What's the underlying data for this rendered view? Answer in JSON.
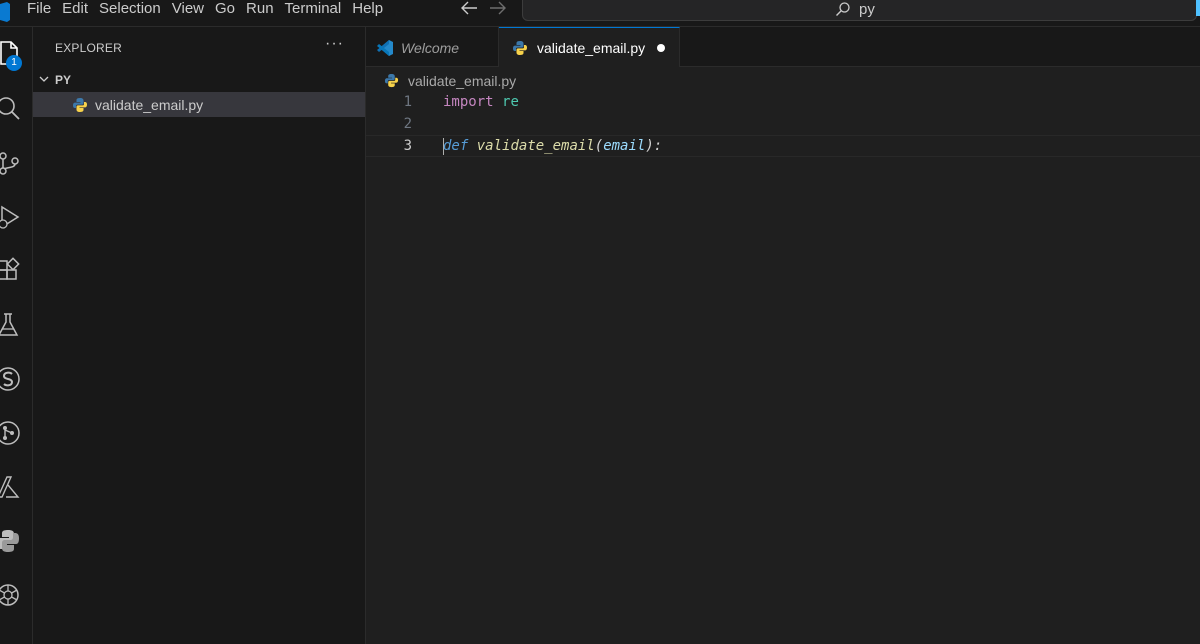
{
  "menu": [
    "File",
    "Edit",
    "Selection",
    "View",
    "Go",
    "Run",
    "Terminal",
    "Help"
  ],
  "command_center": {
    "text": "py"
  },
  "activity_bar": {
    "badge": "1",
    "icons": [
      "explorer-icon",
      "search-icon",
      "source-control-icon",
      "run-debug-icon",
      "extensions-icon",
      "testing-icon",
      "snippets-icon",
      "git-graph-icon",
      "azure-icon",
      "python-icon",
      "openai-icon"
    ]
  },
  "sidebar": {
    "title": "EXPLORER",
    "more_actions": "···",
    "folder": "PY",
    "files": [
      {
        "name": "validate_email.py"
      }
    ]
  },
  "tabs": [
    {
      "label": "Welcome",
      "icon": "vscode-icon",
      "active": false
    },
    {
      "label": "validate_email.py",
      "icon": "python-file-icon",
      "active": true,
      "dirty": true
    }
  ],
  "breadcrumb": {
    "file": "validate_email.py"
  },
  "code": {
    "lines": [
      {
        "n": "1",
        "kw": "import",
        "mod": "re"
      },
      {
        "n": "2"
      },
      {
        "n": "3",
        "def": "def",
        "fn": "validate_email",
        "open": "(",
        "param": "email",
        "close": "):"
      }
    ],
    "current_line": 3
  },
  "colors": {
    "background": "#1f1f1f",
    "sidebar": "#181818",
    "accent": "#0078d4",
    "keyword": "#c586c0",
    "function": "#dcdcaa",
    "parameter": "#9cdcfe"
  }
}
